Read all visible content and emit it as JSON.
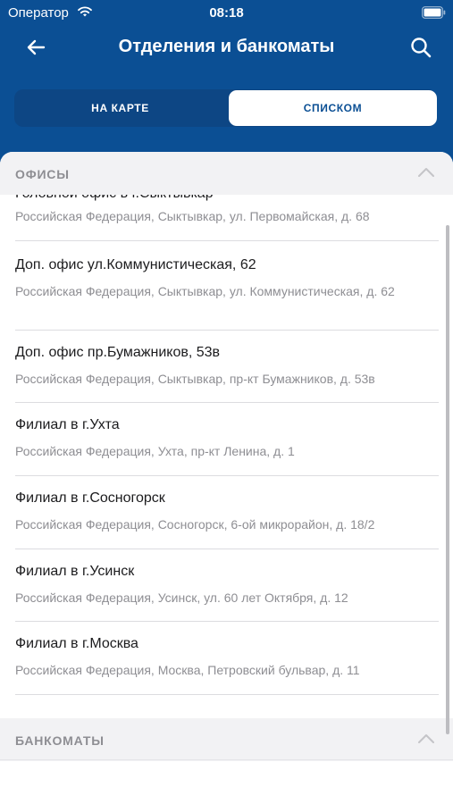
{
  "status_bar": {
    "carrier": "Оператор",
    "time": "08:18"
  },
  "nav": {
    "title": "Отделения и банкоматы",
    "back_icon": "arrow-left-icon",
    "search_icon": "search-icon"
  },
  "segments": {
    "map_label": "НА КАРТЕ",
    "list_label": "СПИСКОМ",
    "selected": "list"
  },
  "sections": {
    "offices": {
      "title": "ОФИСЫ",
      "items": [
        {
          "title": "Головной офис в г.Сыктывкар",
          "address": "Российская Федерация, Сыктывкар, ул. Первомайская, д. 68"
        },
        {
          "title": "Доп. офис ул.Коммунистическая, 62",
          "address": "Российская Федерация, Сыктывкар, ул. Коммунистическая, д. 62"
        },
        {
          "title": "Доп. офис пр.Бумажников, 53в",
          "address": "Российская Федерация, Сыктывкар, пр-кт Бумажников, д. 53в"
        },
        {
          "title": "Филиал в г.Ухта",
          "address": "Российская Федерация, Ухта, пр-кт Ленина, д. 1"
        },
        {
          "title": "Филиал в г.Сосногорск",
          "address": "Российская Федерация, Сосногорск, 6-ой микрорайон, д. 18/2"
        },
        {
          "title": "Филиал в г.Усинск",
          "address": "Российская Федерация, Усинск, ул. 60 лет Октября, д. 12"
        },
        {
          "title": "Филиал в г.Москва",
          "address": "Российская Федерация, Москва, Петровский бульвар, д. 11"
        }
      ]
    },
    "atms": {
      "title": "БАНКОМАТЫ"
    }
  },
  "colors": {
    "header": "#0b4f94",
    "section_bg": "#f2f2f4",
    "secondary_text": "#8e8e93"
  }
}
